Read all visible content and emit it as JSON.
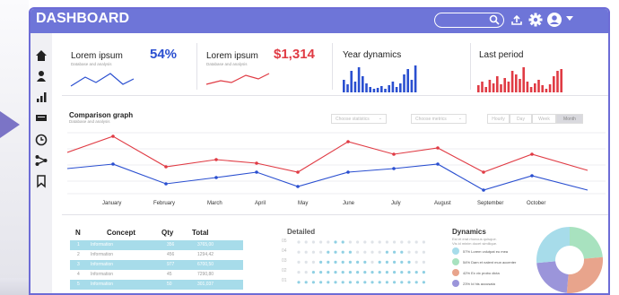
{
  "header": {
    "title": "DASHBOARD",
    "search_placeholder": ""
  },
  "colors": {
    "accent": "#6e75d8",
    "blue": "#2a4fd0",
    "red": "#e03b44",
    "teal": "#a7dcea"
  },
  "sidebar": {
    "items": [
      {
        "icon": "home-icon"
      },
      {
        "icon": "user-icon"
      },
      {
        "icon": "bar-chart-icon"
      },
      {
        "icon": "message-icon"
      },
      {
        "icon": "clock-icon"
      },
      {
        "icon": "share-icon"
      },
      {
        "icon": "bookmark-icon"
      }
    ]
  },
  "cards": {
    "card1": {
      "label": "Lorem ipsum",
      "sub": "Database and analysis",
      "value": "54%"
    },
    "card2": {
      "label": "Lorem ipsum",
      "sub": "Database and analysis",
      "value": "$1,314"
    },
    "card3": {
      "label": "Year dynamics"
    },
    "card4": {
      "label": "Last period"
    }
  },
  "comparison": {
    "title": "Comparison graph",
    "sub": "Database and analysis",
    "dropdown1": "Choose statistics",
    "dropdown2": "Choose metrics",
    "periods": [
      "Hourly",
      "Day",
      "Week",
      "Month"
    ],
    "months": [
      "January",
      "February",
      "March",
      "April",
      "May",
      "June",
      "July",
      "August",
      "September",
      "October"
    ]
  },
  "table": {
    "headers": [
      "N",
      "Concept",
      "Qty",
      "Total"
    ],
    "rows": [
      {
        "n": "1",
        "concept": "Information",
        "qty": "356",
        "total": "3765,00"
      },
      {
        "n": "2",
        "concept": "Information",
        "qty": "456",
        "total": "1294,42"
      },
      {
        "n": "3",
        "concept": "Information",
        "qty": "977",
        "total": "6700,50"
      },
      {
        "n": "4",
        "concept": "Information",
        "qty": "45",
        "total": "7290,80"
      },
      {
        "n": "5",
        "concept": "Information",
        "qty": "50",
        "total": "301,037"
      }
    ]
  },
  "detailed": {
    "title": "Detailed",
    "ylabels": [
      "05",
      "04",
      "03",
      "02",
      "01"
    ]
  },
  "dynamics": {
    "title": "Dynamics",
    "sub1": "Est et erat rhoncus quisque.",
    "sub2": "Vis id minim docet similique.",
    "legend": [
      {
        "label": "57% Lorem volutpat eu mea",
        "color": "#a7dcea"
      },
      {
        "label": "54% Dam et nalent mun accenter",
        "color": "#a8e2bf"
      },
      {
        "label": "42% Ex vix probo dicta",
        "color": "#e8a48c"
      },
      {
        "label": "23% Id his accusata",
        "color": "#9b95da"
      }
    ]
  }
}
